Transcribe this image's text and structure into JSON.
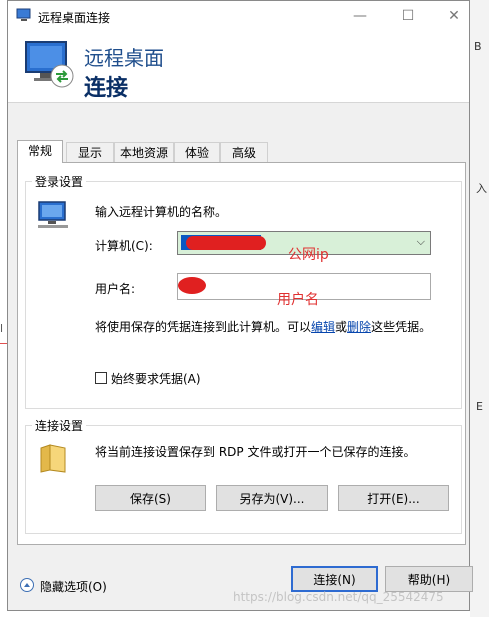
{
  "window": {
    "title": "远程桌面连接",
    "controls": {
      "minimize": "—",
      "maximize": "☐",
      "close": "✕"
    }
  },
  "header": {
    "line1": "远程桌面",
    "line2": "连接"
  },
  "tabs": [
    {
      "label": "常规",
      "active": true
    },
    {
      "label": "显示",
      "active": false
    },
    {
      "label": "本地资源",
      "active": false
    },
    {
      "label": "体验",
      "active": false
    },
    {
      "label": "高级",
      "active": false
    }
  ],
  "login": {
    "group_title": "登录设置",
    "prompt": "输入远程计算机的名称。",
    "computer_label": "计算机(C):",
    "username_label": "用户名:",
    "hint_prefix": "将使用保存的凭据连接到此计算机。可以",
    "hint_edit": "编辑",
    "hint_or": "或",
    "hint_delete": "删除",
    "hint_suffix": "这些凭据。",
    "always_ask": "始终要求凭据(A)"
  },
  "annotations": {
    "public_ip": "公网ip",
    "username": "用户名"
  },
  "connection": {
    "group_title": "连接设置",
    "description": "将当前连接设置保存到 RDP 文件或打开一个已保存的连接。",
    "save": "保存(S)",
    "save_as": "另存为(V)...",
    "open": "打开(E)..."
  },
  "footer": {
    "hide_options": "隐藏选项(O)",
    "connect": "连接(N)",
    "help": "帮助(H)"
  },
  "watermark": "https://blog.csdn.net/qq_25542475",
  "colors": {
    "accent": "#2e6bd1",
    "annotation": "#e03030",
    "header_text": "#1f4e8c"
  }
}
